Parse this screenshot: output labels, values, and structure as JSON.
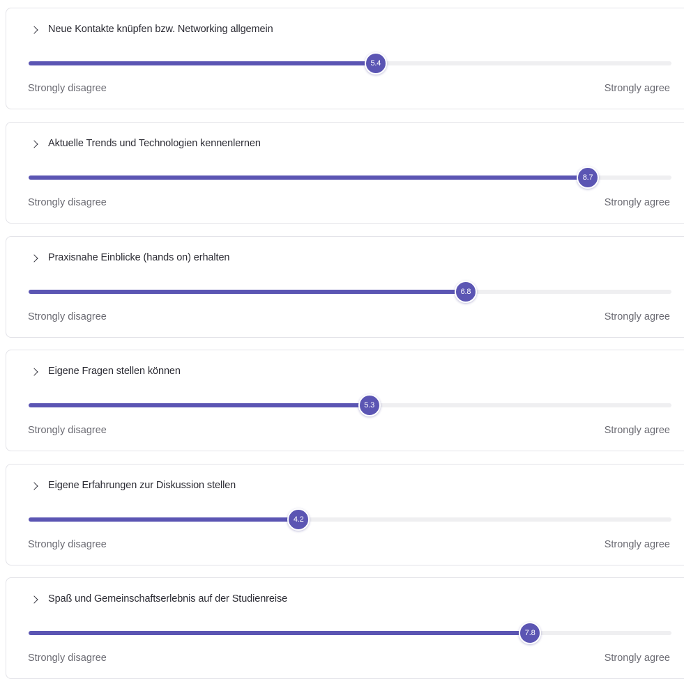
{
  "scale": {
    "min": 0,
    "max": 10,
    "min_label": "Strongly disagree",
    "max_label": "Strongly agree"
  },
  "accent_color": "#5b55b3",
  "track_color": "#efeff1",
  "icon": "chevron-right-icon",
  "questions": [
    {
      "title": "Neue Kontakte knüpfen bzw. Networking allgemein",
      "value": 5.4,
      "value_label": "5.4"
    },
    {
      "title": "Aktuelle Trends und Technologien kennenlernen",
      "value": 8.7,
      "value_label": "8.7"
    },
    {
      "title": "Praxisnahe Einblicke (hands on) erhalten",
      "value": 6.8,
      "value_label": "6.8"
    },
    {
      "title": "Eigene Fragen stellen können",
      "value": 5.3,
      "value_label": "5.3"
    },
    {
      "title": "Eigene Erfahrungen zur Diskussion stellen",
      "value": 4.2,
      "value_label": "4.2"
    },
    {
      "title": "Spaß und Gemeinschaftserlebnis auf der Studienreise",
      "value": 7.8,
      "value_label": "7.8"
    }
  ]
}
